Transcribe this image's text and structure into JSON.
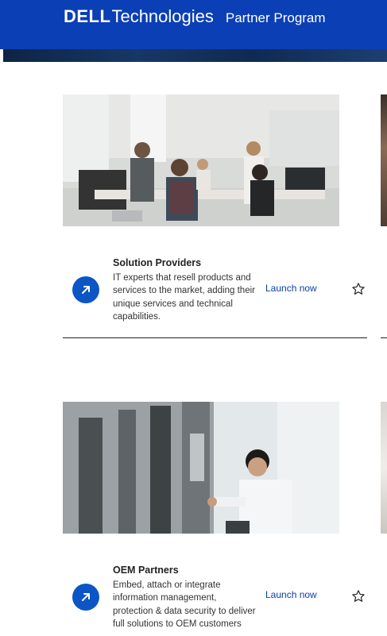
{
  "header": {
    "brand": "DELL",
    "product": "Technologies",
    "program": "Partner Program"
  },
  "cards": [
    {
      "title": "Solution Providers",
      "description": "IT experts that resell products and services to the market, adding their unique services and technical capabilities.",
      "action": "Launch now"
    },
    {
      "title": "OEM Partners",
      "description": "Embed, attach or integrate information management, protection & data security to deliver full solutions to OEM customers",
      "action": "Launch now"
    }
  ],
  "icons": {
    "launch": "arrow-up-right-icon",
    "favorite": "star-outline-icon"
  },
  "colors": {
    "header_bg": "#0b3fb6",
    "accent": "#0c55c5",
    "link": "#0b3fa6"
  }
}
